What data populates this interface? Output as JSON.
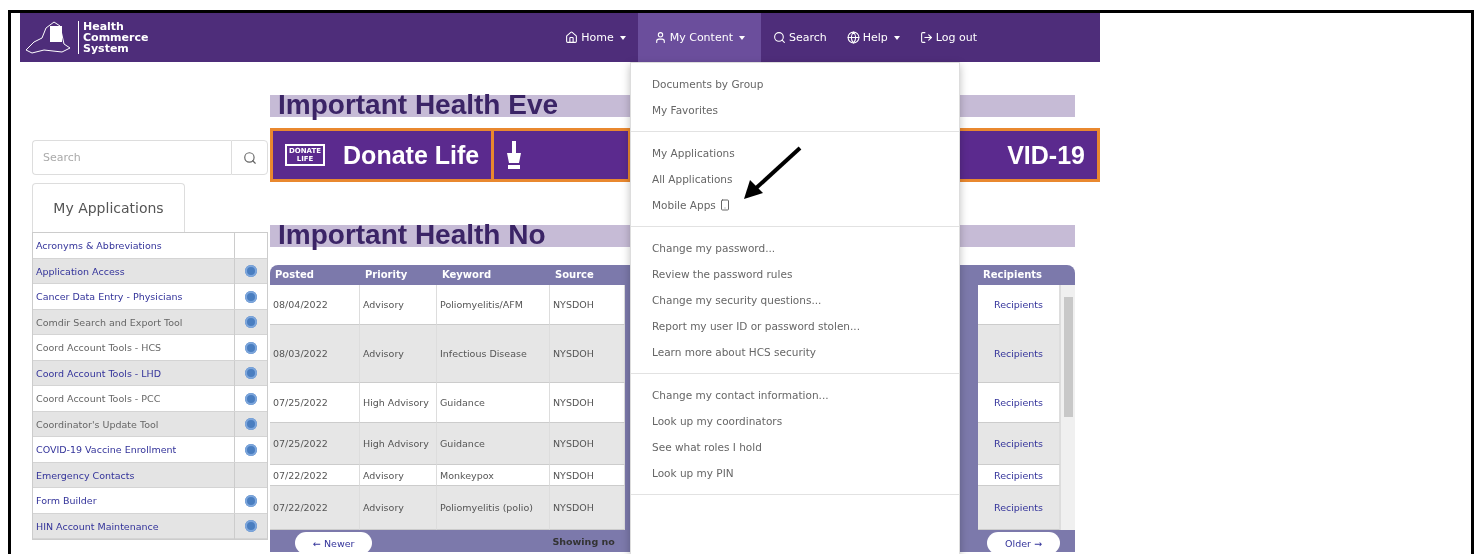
{
  "header": {
    "logo_text": [
      "Health",
      "Commerce",
      "System"
    ],
    "nav": [
      {
        "label": "Home",
        "dropdown": true,
        "selected": false
      },
      {
        "label": "My Content",
        "dropdown": true,
        "selected": true
      },
      {
        "label": "Search",
        "dropdown": false,
        "selected": false
      },
      {
        "label": "Help",
        "dropdown": true,
        "selected": false
      },
      {
        "label": "Log out",
        "dropdown": false,
        "selected": false
      }
    ]
  },
  "sidebar": {
    "search": {
      "placeholder": "Search"
    },
    "tabs": [
      {
        "label": "My Applications",
        "selected": true
      }
    ],
    "apps": [
      {
        "name": "Acronyms & Abbreviations",
        "visited": false,
        "info": false
      },
      {
        "name": "Application Access",
        "visited": false,
        "info": true
      },
      {
        "name": "Cancer Data Entry - Physicians",
        "visited": false,
        "info": true
      },
      {
        "name": "Comdir Search and Export Tool",
        "visited": true,
        "info": true
      },
      {
        "name": "Coord Account Tools - HCS",
        "visited": true,
        "info": true
      },
      {
        "name": "Coord Account Tools - LHD",
        "visited": false,
        "info": true
      },
      {
        "name": "Coord Account Tools - PCC",
        "visited": true,
        "info": true
      },
      {
        "name": "Coordinator's Update Tool",
        "visited": true,
        "info": true
      },
      {
        "name": "COVID-19 Vaccine Enrollment",
        "visited": false,
        "info": true
      },
      {
        "name": "Emergency Contacts",
        "visited": false,
        "info": false
      },
      {
        "name": "Form Builder",
        "visited": false,
        "info": true
      },
      {
        "name": "HIN Account Maintenance",
        "visited": false,
        "info": true
      }
    ]
  },
  "events": {
    "heading": "Important Health Eve",
    "banner": [
      {
        "kind": "logo",
        "lines": [
          "DONATE",
          "LIFE"
        ],
        "text": "Donate Life"
      },
      {
        "kind": "icon"
      },
      {
        "kind": "text",
        "text": "VID-19"
      }
    ]
  },
  "notices": {
    "heading": "Important Health No",
    "columns": [
      "Posted",
      "Priority",
      "Keyword",
      "Source",
      "Recipients"
    ],
    "rows": [
      {
        "posted": "08/04/2022",
        "priority": "Advisory",
        "keyword": "Poliomyelitis/AFM",
        "source": "NYSDOH",
        "recipients": "Recipients"
      },
      {
        "posted": "08/03/2022",
        "priority": "Advisory",
        "keyword": "Infectious Disease",
        "source": "NYSDOH",
        "recipients": "Recipients"
      },
      {
        "posted": "07/25/2022",
        "priority": "High Advisory",
        "keyword": "Guidance",
        "source": "NYSDOH",
        "recipients": "Recipients"
      },
      {
        "posted": "07/25/2022",
        "priority": "High Advisory",
        "keyword": "Guidance",
        "source": "NYSDOH",
        "recipients": "Recipients"
      },
      {
        "posted": "07/22/2022",
        "priority": "Advisory",
        "keyword": "Monkeypox",
        "source": "NYSDOH",
        "recipients": "Recipients"
      },
      {
        "posted": "07/22/2022",
        "priority": "Advisory",
        "keyword": "Poliomyelitis (polio)",
        "source": "NYSDOH",
        "recipients": "Recipients"
      }
    ],
    "newer": "← Newer",
    "showing": "Showing no",
    "older": "Older →"
  },
  "menu": {
    "groups": [
      [
        {
          "label": "Documents by Group",
          "device": false
        },
        {
          "label": "My Favorites",
          "device": false
        }
      ],
      [
        {
          "label": "My Applications",
          "device": false
        },
        {
          "label": "All Applications",
          "device": false
        },
        {
          "label": "Mobile Apps",
          "device": true
        }
      ],
      [
        {
          "label": "Change my password...",
          "device": false
        },
        {
          "label": "Review the password rules",
          "device": false
        },
        {
          "label": "Change my security questions...",
          "device": false
        },
        {
          "label": "Report my user ID or password stolen...",
          "device": false
        },
        {
          "label": "Learn more about HCS security",
          "device": false
        }
      ],
      [
        {
          "label": "Change my contact information...",
          "device": false
        },
        {
          "label": "Look up my coordinators",
          "device": false
        },
        {
          "label": "See what roles I hold",
          "device": false
        },
        {
          "label": "Look up my PIN",
          "device": false
        }
      ]
    ]
  }
}
